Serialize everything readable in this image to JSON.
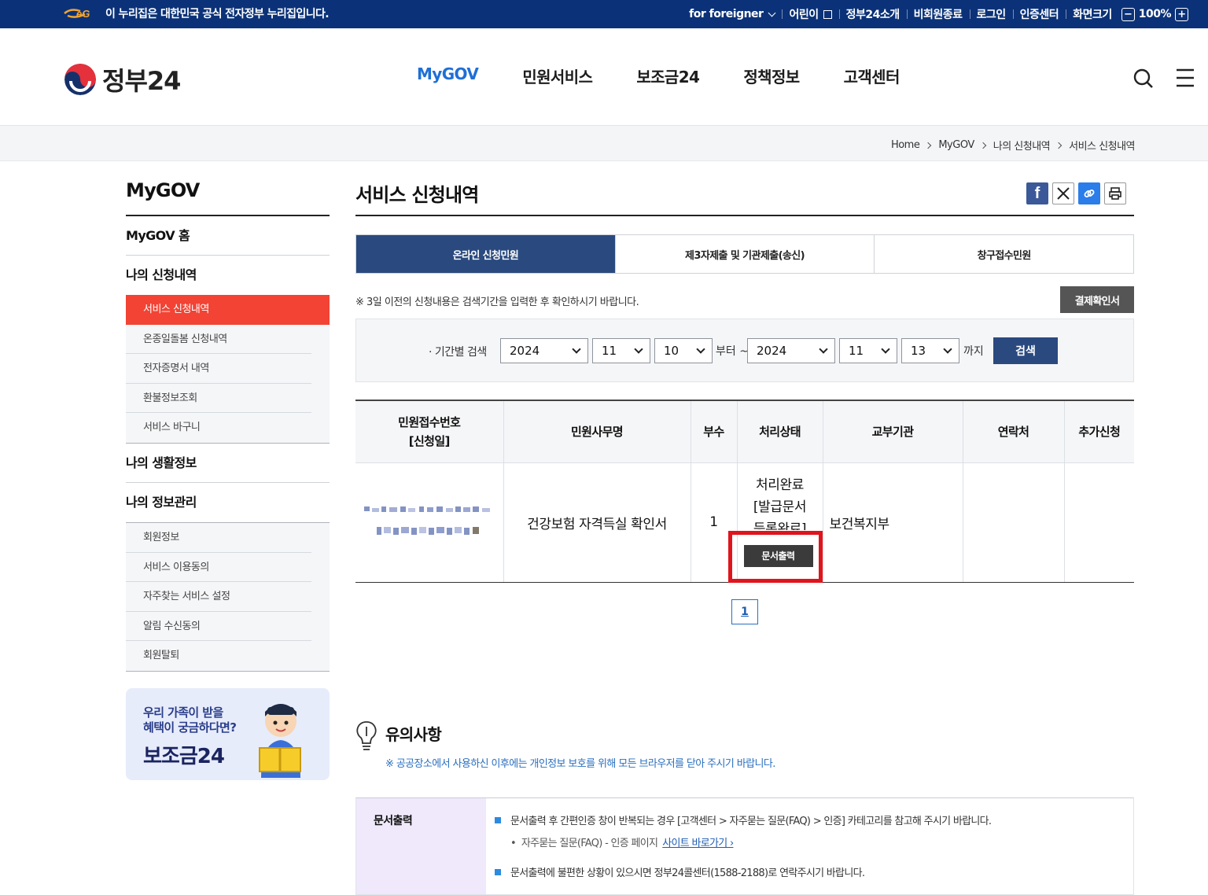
{
  "topbar": {
    "notice": "이 누리집은 대한민국 공식 전자정부 누리집입니다.",
    "links": [
      {
        "label": "for foreigner"
      },
      {
        "label": "어린이"
      },
      {
        "label": "정부24소개"
      },
      {
        "label": "비회원종료"
      },
      {
        "label": "로그인"
      },
      {
        "label": "인증센터"
      },
      {
        "label": "화면크기"
      }
    ],
    "zoom_value": "100%",
    "zoom_minus": "−",
    "zoom_plus": "+"
  },
  "header": {
    "logo_text": "정부24",
    "gnb": [
      "MyGOV",
      "민원서비스",
      "보조금24",
      "정책정보",
      "고객센터"
    ],
    "active_gnb": "MyGOV"
  },
  "breadcrumb": [
    "Home",
    "MyGOV",
    "나의 신청내역",
    "서비스 신청내역"
  ],
  "sidebar": {
    "title": "MyGOV",
    "home": "MyGOV 홈",
    "group1": {
      "title": "나의 신청내역",
      "items": [
        "서비스 신청내역",
        "온종일돌봄 신청내역",
        "전자증명서 내역",
        "환불정보조회",
        "서비스 바구니"
      ]
    },
    "group2": {
      "title": "나의 생활정보"
    },
    "group3": {
      "title": "나의 정보관리",
      "items": [
        "회원정보",
        "서비스 이용동의",
        "자주찾는 서비스 설정",
        "알림 수신동의",
        "회원탈퇴"
      ]
    },
    "banner": {
      "line1": "우리 가족이 받을",
      "line2": "혜택이 궁금하다면?",
      "line3": "보조금24"
    }
  },
  "main": {
    "title": "서비스 신청내역",
    "tabs": [
      "온라인 신청민원",
      "제3자제출 및 기관제출(송신)",
      "창구접수민원"
    ],
    "note": "※ 3일 이전의 신청내용은 검색기간을 입력한 후 확인하시기 바랍니다.",
    "pay_button": "결제확인서",
    "search": {
      "label": "기간별 검색",
      "from_year": "2024",
      "from_month": "11",
      "from_day": "10",
      "from_word": "부터 ~",
      "to_year": "2024",
      "to_month": "11",
      "to_day": "13",
      "to_word": "까지",
      "button": "검색"
    },
    "table": {
      "headers": [
        "민원접수번호\n[신청일]",
        "민원사무명",
        "부수",
        "처리상태",
        "교부기관",
        "연락처",
        "추가신청"
      ],
      "header_lines": [
        [
          "민원접수번호",
          "[신청일]"
        ],
        [
          "민원사무명"
        ],
        [
          "부수"
        ],
        [
          "처리상태"
        ],
        [
          "교부기관"
        ],
        [
          "연락처"
        ],
        [
          "추가신청"
        ]
      ],
      "rows": [
        {
          "service": "건강보험 자격득실 확인서",
          "copies": "1",
          "status_line1": "처리완료",
          "status_line2": "[발급문서",
          "status_line3": "등록완료]",
          "print_button": "문서출력",
          "agency": "보건복지부",
          "contact": "",
          "extra": ""
        }
      ]
    },
    "pagination": [
      "1"
    ],
    "caution": {
      "title": "유의사항",
      "sub": "※ 공공장소에서 사용하신 이후에는 개인정보 보호를 위해 모든 브라우저를 닫아 주시기 바랍니다.",
      "row_title": "문서출력",
      "item1": "문서출력 후 간편인증 창이 반복되는 경우 [고객센터 > 자주묻는 질문(FAQ) > 인증] 카테고리를 참고해 주시기 바랍니다.",
      "item1_sub": "자주묻는 질문(FAQ) - 인증 페이지",
      "item1_link": "사이트 바로가기",
      "item2": "문서출력에 불편한 상황이 있으시면 정부24콜센터(1588-2188)로 연락주시기 바랍니다."
    }
  },
  "colors": {
    "topbar_bg": "#0b3278",
    "accent_blue": "#1f6fd6",
    "nav_active": "#f24334",
    "tab_active": "#2a4a7f",
    "highlight": "#e0141c"
  }
}
